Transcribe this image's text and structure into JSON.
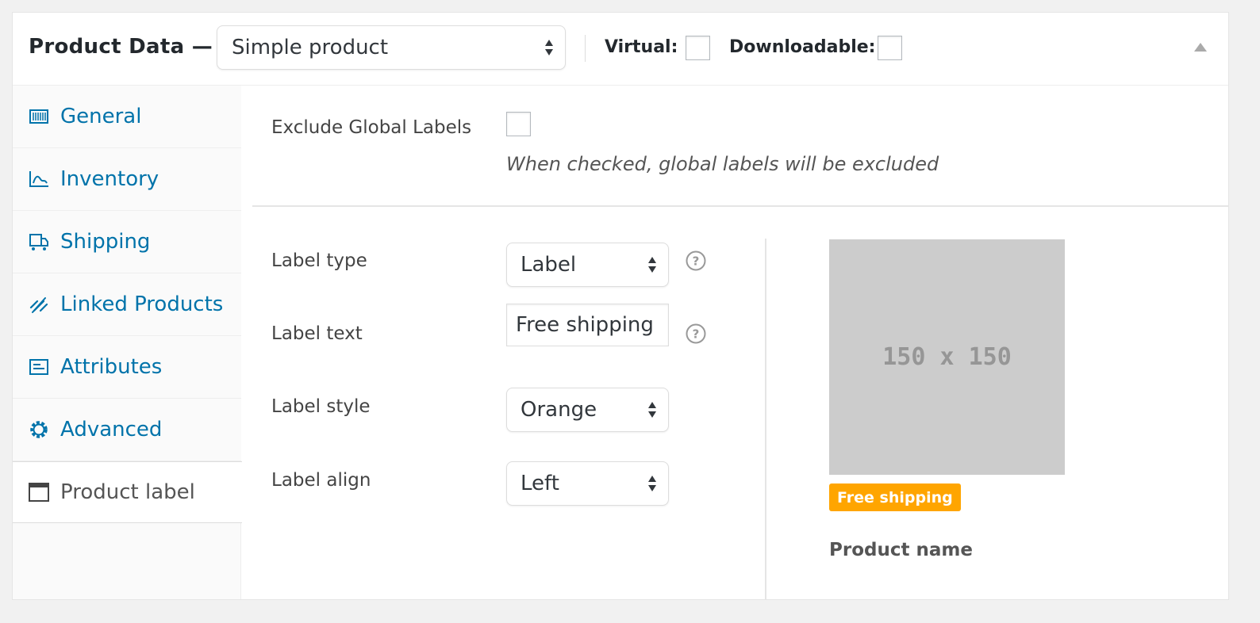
{
  "header": {
    "title": "Product Data —",
    "product_type": "Simple product",
    "virtual_label": "Virtual:",
    "downloadable_label": "Downloadable:"
  },
  "sidebar": {
    "items": [
      {
        "label": "General",
        "icon": "barcode-icon",
        "active": false
      },
      {
        "label": "Inventory",
        "icon": "chart-icon",
        "active": false
      },
      {
        "label": "Shipping",
        "icon": "truck-icon",
        "active": false
      },
      {
        "label": "Linked Products",
        "icon": "link-icon",
        "active": false
      },
      {
        "label": "Attributes",
        "icon": "list-icon",
        "active": false
      },
      {
        "label": "Advanced",
        "icon": "gear-icon",
        "active": false
      },
      {
        "label": "Product label",
        "icon": "window-icon",
        "active": true
      }
    ]
  },
  "form": {
    "exclude_label": "Exclude Global Labels",
    "exclude_desc": "When checked, global labels will be excluded",
    "label_type_label": "Label type",
    "label_type_value": "Label",
    "label_text_label": "Label text",
    "label_text_value": "Free shipping",
    "label_style_label": "Label style",
    "label_style_value": "Orange",
    "label_align_label": "Label align",
    "label_align_value": "Left"
  },
  "preview": {
    "placeholder": "150 x 150",
    "badge": "Free shipping",
    "product_name": "Product name"
  },
  "colors": {
    "link": "#0073aa",
    "badge": "#ffa500",
    "placeholder_bg": "#cccccc"
  }
}
